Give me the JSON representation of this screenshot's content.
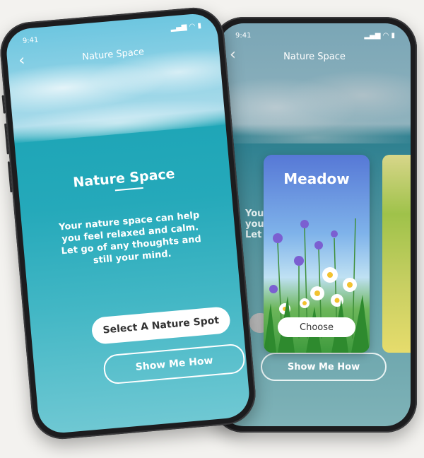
{
  "status": {
    "time": "9:41",
    "icons": "▂▄▆ ◠ ▮"
  },
  "nav": {
    "title": "Nature Space",
    "back_icon": "‹"
  },
  "left_screen": {
    "heading": "Nature Space",
    "body": "Your nature space can help you feel relaxed and calm. Let go of any thoughts and still your mind.",
    "primary_button": "Select A Nature Spot",
    "secondary_button": "Show Me How"
  },
  "right_screen": {
    "partial_text": "Your\nyou\nLet",
    "card": {
      "title": "Meadow",
      "choose": "Choose"
    },
    "secondary_button": "Show Me How"
  }
}
